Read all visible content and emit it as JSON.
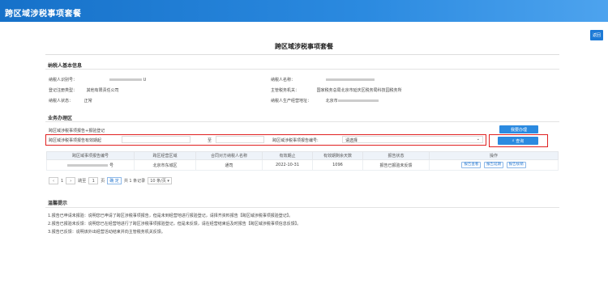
{
  "header": {
    "app_title": "跨区域涉税事项套餐",
    "back_label": "返回"
  },
  "page": {
    "title": "跨区域涉税事项套餐"
  },
  "taxpayer": {
    "section_title": "纳税人基本信息",
    "fields": [
      {
        "label": "纳税人识别号：",
        "value": "U"
      },
      {
        "label": "纳税人名称：",
        "value": ""
      },
      {
        "label": "登记注册类型：",
        "value": "其他有限责任公司"
      },
      {
        "label": "主管税务机关：",
        "value": "国家税务总局北京市延庆区税务局科技园税务所"
      },
      {
        "label": "纳税人状态：",
        "value": "正常"
      },
      {
        "label": "纳税人生产经营地址：",
        "value": "北京市"
      }
    ]
  },
  "business": {
    "section_title": "业务办理区",
    "row1_label": "跨区域涉税事项报告+报验登记",
    "handle_button": "我要办理",
    "date_label": "跨区域涉税事项报告有效期起",
    "date_sep": "至",
    "number_label": "跨区域涉税事项报告编号:",
    "select_value": "请选择",
    "query_button": "查询"
  },
  "table": {
    "columns": [
      "跨区域事项报告编号",
      "跨区经营区域",
      "合同对方纳税人名称",
      "有效期止",
      "有效期剩余天数",
      "报告状态",
      "操作"
    ],
    "rows": [
      {
        "number": "号",
        "region": "北京市东城区",
        "party": "通司",
        "end_date": "2022-10-31",
        "days": "1096",
        "status": "报告已报验未反馈",
        "ops": [
          "报告查看",
          "报告延期",
          "报告核销"
        ]
      }
    ]
  },
  "pager": {
    "prev": "‹",
    "page": "1",
    "next": "›",
    "goto_label": "跳至",
    "goto_value": "1",
    "page_unit": "页",
    "confirm": "确 定",
    "total": "共 1 条记录",
    "page_size": "10 条/页"
  },
  "tips": {
    "title": "温馨提示",
    "lines": [
      "1.报告已申请未报验：说明您已申请了跨区涉税事项报告，但是未到经营地进行报验登记，请择齐资料报告【跨区域涉税事项报验登记】。",
      "2.报告已报验未反馈：说明您已在经营地进行了跨区涉税事项报验登记，但是未反馈，请在经营结束后及时报告【跨区域涉税事项信息反馈】。",
      "3.报告已反馈：说明该外出经营活动结束并向主管税务机关反馈。"
    ]
  }
}
